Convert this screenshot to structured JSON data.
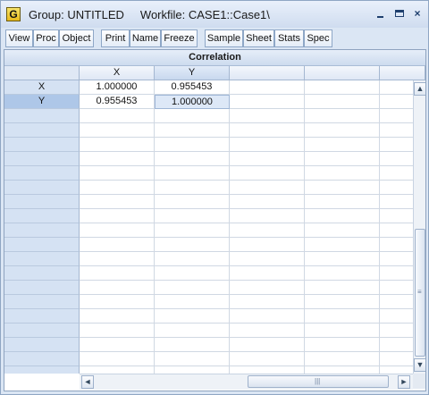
{
  "window": {
    "icon_letter": "G",
    "title": "Group: UNTITLED",
    "workfile": "Workfile: CASE1::Case1\\",
    "min_glyph": "_",
    "max_glyph": "□",
    "close_glyph": "×"
  },
  "toolbar": {
    "buttons": [
      "View",
      "Proc",
      "Object",
      "Print",
      "Name",
      "Freeze",
      "Sample",
      "Sheet",
      "Stats",
      "Spec"
    ]
  },
  "sheet": {
    "title": "Correlation",
    "columns": [
      "X",
      "Y",
      "",
      "",
      ""
    ],
    "rows": [
      {
        "label": "X",
        "values": [
          "1.000000",
          "0.955453"
        ]
      },
      {
        "label": "Y",
        "values": [
          "0.955453",
          "1.000000"
        ]
      }
    ],
    "selected_row": 1,
    "current_cell": {
      "row": 1,
      "col": 1
    }
  },
  "scroll": {
    "up": "▲",
    "down": "▼",
    "left": "◄",
    "right": "►"
  }
}
